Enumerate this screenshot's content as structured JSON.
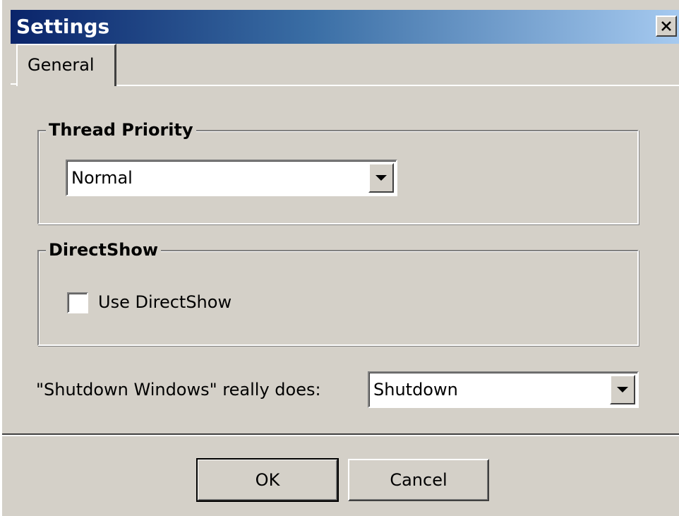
{
  "window": {
    "title": "Settings",
    "close_glyph": "×"
  },
  "tabs": [
    {
      "label": "General",
      "selected": true
    }
  ],
  "thread_priority": {
    "group_title": "Thread Priority",
    "selected_value": "Normal"
  },
  "directshow": {
    "group_title": "DirectShow",
    "checkbox_label": "Use DirectShow",
    "checked": false
  },
  "shutdown": {
    "label": "\"Shutdown Windows\" really does:",
    "selected_value": "Shutdown"
  },
  "buttons": {
    "ok_label": "OK",
    "cancel_label": "Cancel"
  },
  "colors": {
    "titlebar_start": "#0a246a",
    "titlebar_end": "#a6caf0",
    "face": "#d4d0c8"
  }
}
